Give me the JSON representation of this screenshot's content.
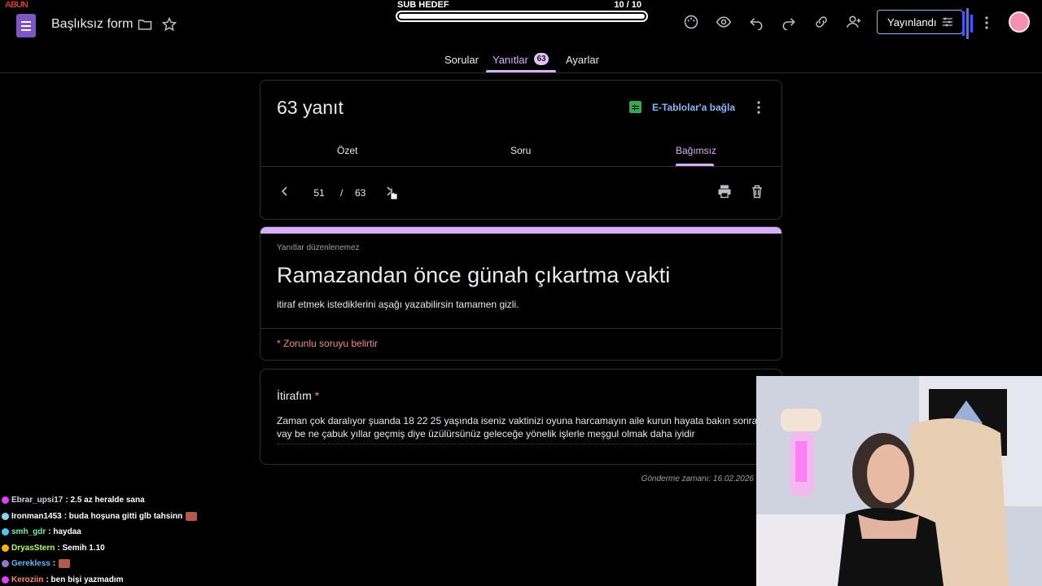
{
  "header": {
    "brand_mark": "ABUN",
    "form_title": "Başlıksız form",
    "publish_label": "Yayınlandı"
  },
  "stream": {
    "subgoal_label": "SUB HEDEF",
    "subgoal_count": "10  / 10",
    "subgoal_progress": 1.0
  },
  "tabs": {
    "questions": "Sorular",
    "responses": "Yanıtlar",
    "responses_badge": "63",
    "settings": "Ayarlar"
  },
  "summary_card": {
    "response_count": "63 yanıt",
    "sheets_link": "E-Tablolar'a bağla",
    "sub_tabs": [
      "Özet",
      "Soru",
      "Bağımsız"
    ],
    "active_sub_tab": "Bağımsız",
    "pager": {
      "current": "51",
      "separator": "/",
      "total": "63"
    }
  },
  "form_card": {
    "notice": "Yanıtlar düzenlenemez",
    "title": "Ramazandan önce günah çıkartma vakti",
    "description": "itiraf etmek istediklerini aşağı yazabilirsin tamamen gizli.",
    "required_note": "* Zorunlu soruyu belirtir"
  },
  "question_card": {
    "question": "İtirafım",
    "required_star": "*",
    "answer": "Zaman çok daralıyor  şuanda 18 22 25 yaşında iseniz vaktinizi oyuna harcamayın aile kurun hayata bakın sonra vay be ne çabuk yıllar geçmiş diye üzülürsünüz  geleceğe yönelik işlerle meşgul olmak daha iyidir"
  },
  "submitted_at": "Gönderme zamanı: 16.02.2026",
  "chat": [
    {
      "user": "Ebrar_upsi17",
      "message": ": 2.5 az heralde sana",
      "color": "#cfd8dc",
      "badge": "#e040fb",
      "emote": false
    },
    {
      "user": "Ironman1453",
      "message": ": buda hoşuna gitti glb tahsinn",
      "color": "#ffffff",
      "badge": "#81d4fa",
      "emote": true
    },
    {
      "user": "smh_gdr",
      "message": ": haydaa",
      "color": "#69f0ae",
      "badge": "#4fc3f7",
      "emote": false
    },
    {
      "user": "DryasStern",
      "message": ": Semih 1.10",
      "color": "#b2ff59",
      "badge": "#ffb300",
      "emote": false
    },
    {
      "user": "Gerekless",
      "message": ":",
      "color": "#64b5f6",
      "badge": "#9575cd",
      "emote": true
    },
    {
      "user": "Keroziin",
      "message": ": ben bişi yazmadım",
      "color": "#ff8a65",
      "badge": "#e040fb",
      "emote": false
    }
  ]
}
